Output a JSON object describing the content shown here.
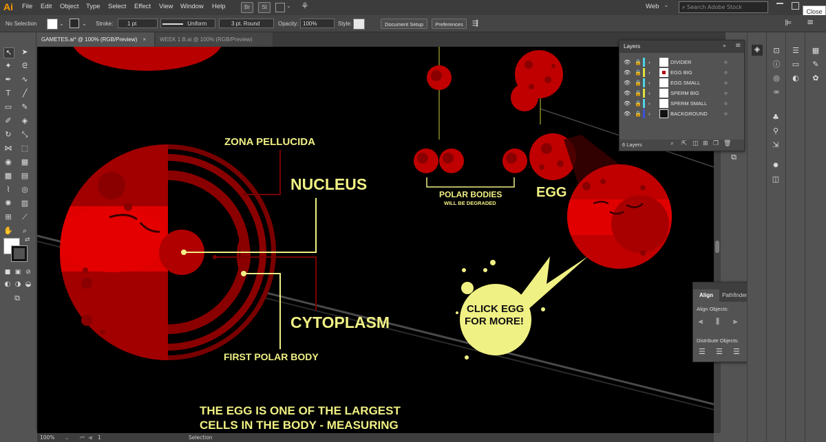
{
  "app": {
    "logo": "Ai",
    "close_label": "Close"
  },
  "menu": [
    "File",
    "Edit",
    "Object",
    "Type",
    "Select",
    "Effect",
    "View",
    "Window",
    "Help"
  ],
  "menubar_right": {
    "bridge": "Br",
    "stock": "St",
    "workspace": "Web",
    "search_placeholder": "Search Adobe Stock"
  },
  "control": {
    "selection": "No Selection",
    "stroke_label": "Stroke:",
    "stroke_value": "1 pt",
    "profile_value": "Uniform",
    "brush_value": "3 pt. Round",
    "opacity_label": "Opacity:",
    "opacity_value": "100%",
    "style_label": "Style:",
    "doc_setup": "Document Setup",
    "preferences": "Preferences"
  },
  "tabs": [
    {
      "label": "GAMETES.ai* @ 100% (RGB/Preview)",
      "active": true
    },
    {
      "label": "WEEK 1 B.ai @ 100% (RGB/Preview)",
      "active": false
    }
  ],
  "artboard": {
    "zona": "ZONA PELLUCIDA",
    "nucleus": "NUCLEUS",
    "cytoplasm": "CYTOPLASM",
    "first_polar": "FIRST POLAR BODY",
    "polar_bodies": "POLAR BODIES",
    "degraded": "WILL BE DEGRADED",
    "egg": "EGG",
    "click_line1": "CLICK EGG",
    "click_line2": "FOR  MORE!",
    "caption_line1": "THE EGG IS ONE OF THE LARGEST",
    "caption_line2": "CELLS IN THE BODY  - MEASURING"
  },
  "layers_panel": {
    "title": "Layers",
    "layers": [
      {
        "name": "DIVIDER",
        "color": "#4fd5e8"
      },
      {
        "name": "EGG BIG",
        "color": "#e0e040"
      },
      {
        "name": "EGG SMALL",
        "color": "#4fd5e8"
      },
      {
        "name": "SPERM BIG",
        "color": "#e0e040"
      },
      {
        "name": "SPERM SMALL",
        "color": "#4fd5e8"
      },
      {
        "name": "BACKGROUND",
        "color": "#3f51d8"
      }
    ],
    "count": "6 Layers"
  },
  "align_panel": {
    "tab_align": "Align",
    "tab_pathfinder": "Pathfinder",
    "align_objects": "Align Objects:",
    "distribute_objects": "Distribute Objects:"
  },
  "status": {
    "zoom": "100%",
    "artboard_num": "1",
    "tool": "Selection"
  },
  "colors": {
    "canvas": "#000000",
    "label_yellow": "#f0f184",
    "cell_red": "#c40000",
    "cell_dark": "#8a0000"
  }
}
